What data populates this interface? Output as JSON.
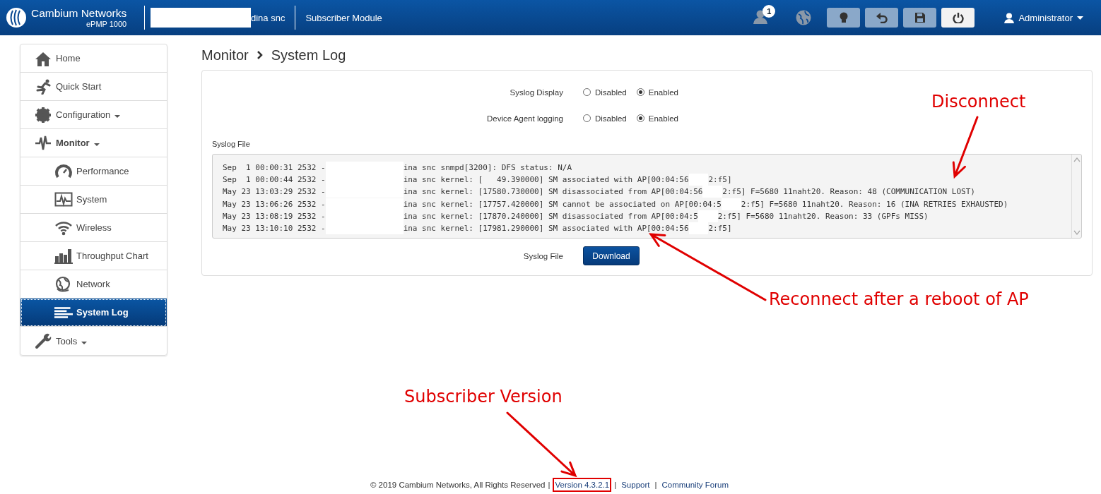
{
  "header": {
    "brand": "Cambium Networks",
    "model": "ePMP 1000",
    "site_name": "dina snc",
    "device_type": "Subscriber Module",
    "notification_count": "1",
    "user": "Administrator",
    "buttons": [
      {
        "kind": "bulb",
        "highlighted": false
      },
      {
        "kind": "undo",
        "highlighted": false
      },
      {
        "kind": "save",
        "highlighted": false
      },
      {
        "kind": "power",
        "highlighted": true
      }
    ]
  },
  "sidebar": {
    "items": [
      {
        "label": "Home",
        "kind": "home",
        "menu": false,
        "expanded": false,
        "selected": false
      },
      {
        "label": "Quick Start",
        "kind": "run",
        "menu": false,
        "expanded": false,
        "selected": false
      },
      {
        "label": "Configuration",
        "kind": "gear",
        "menu": true,
        "expanded": false,
        "selected": false
      },
      {
        "label": "Monitor",
        "kind": "pulse",
        "menu": true,
        "expanded": true,
        "selected": false,
        "children": [
          {
            "label": "Performance",
            "kind": "gauge",
            "selected": false
          },
          {
            "label": "System",
            "kind": "monitor",
            "selected": false
          },
          {
            "label": "Wireless",
            "kind": "wifi",
            "selected": false
          },
          {
            "label": "Throughput Chart",
            "kind": "bars",
            "selected": false
          },
          {
            "label": "Network",
            "kind": "globe",
            "selected": false
          },
          {
            "label": "System Log",
            "kind": "lines",
            "selected": true
          }
        ]
      },
      {
        "label": "Tools",
        "kind": "wrench",
        "menu": true,
        "expanded": false,
        "selected": false
      }
    ]
  },
  "breadcrumb": [
    "Monitor",
    "System Log"
  ],
  "settings": [
    {
      "label": "Syslog Display",
      "options": [
        {
          "label": "Disabled",
          "selected": false
        },
        {
          "label": "Enabled",
          "selected": true
        }
      ]
    },
    {
      "label": "Device Agent logging",
      "options": [
        {
          "label": "Disabled",
          "selected": false
        },
        {
          "label": "Enabled",
          "selected": true
        }
      ]
    }
  ],
  "syslog_file": {
    "label": "Syslog File",
    "lines": [
      {
        "segments": [
          "Sep  1 00:00:31 2532 -",
          "ina snc snmpd[3200]: DFS status: N/A"
        ]
      },
      {
        "segments": [
          "Sep  1 00:00:44 2532 -",
          "ina snc kernel: [   49.390000] SM associated with AP[00:04:56",
          "2:f5]"
        ]
      },
      {
        "segments": [
          "May 23 13:03:29 2532 -",
          "ina snc kernel: [17580.730000] SM disassociated from AP[00:04:56",
          "2:f5] F=5680 11naht20. Reason: 48 (COMMUNICATION LOST)"
        ]
      },
      {
        "segments": [
          "May 23 13:06:26 2532 -",
          "ina snc kernel: [17757.420000] SM cannot be associated on AP[00:04:5",
          "2:f5] F=5680 11naht20. Reason: 16 (INA RETRIES EXHAUSTED)"
        ]
      },
      {
        "segments": [
          "May 23 13:08:19 2532 -",
          "ina snc kernel: [17870.240000] SM disassociated from AP[00:04:5",
          "2:f5] F=5680 11naht20. Reason: 33 (GPFs MISS)"
        ]
      },
      {
        "segments": [
          "May 23 13:10:10 2532 -",
          "ina snc kernel: [17981.290000] SM associated with AP[00:04:56",
          "2:f5]"
        ]
      }
    ]
  },
  "download": {
    "label": "Syslog File",
    "button": "Download"
  },
  "footer": {
    "copyright": "© 2019 Cambium Networks, All Rights Reserved",
    "links": [
      {
        "separator": "|",
        "label": "Version 4.3.2.1",
        "highlighted": true
      },
      {
        "separator": "|",
        "label": "Support",
        "highlighted": false
      },
      {
        "separator": "|",
        "label": "Community Forum",
        "highlighted": false
      }
    ]
  },
  "annotations": [
    "Disconnect",
    "Reconnect after a reboot of AP",
    "Subscriber Version"
  ]
}
